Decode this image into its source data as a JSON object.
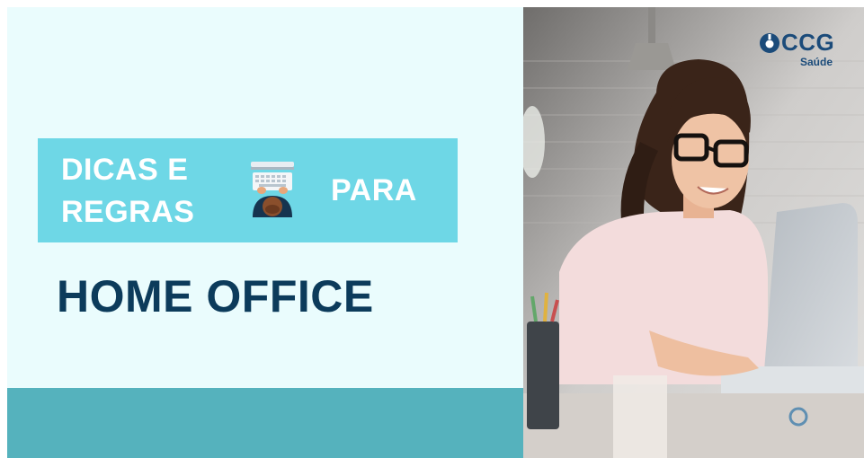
{
  "banner": {
    "line1": "DICAS E",
    "line2": "REGRAS",
    "line3": "PARA",
    "icon": "person-at-laptop-icon"
  },
  "headline": "HOME OFFICE",
  "logo": {
    "name": "CCG",
    "sub": "Saúde"
  },
  "photo": {
    "subject": "woman-with-glasses-using-laptop"
  },
  "colors": {
    "panel_bg": "#eafcfd",
    "banner_bg": "#6ed7e6",
    "bottom_band": "#55b2bd",
    "headline": "#0c3b5b",
    "logo": "#1b4b7a"
  }
}
